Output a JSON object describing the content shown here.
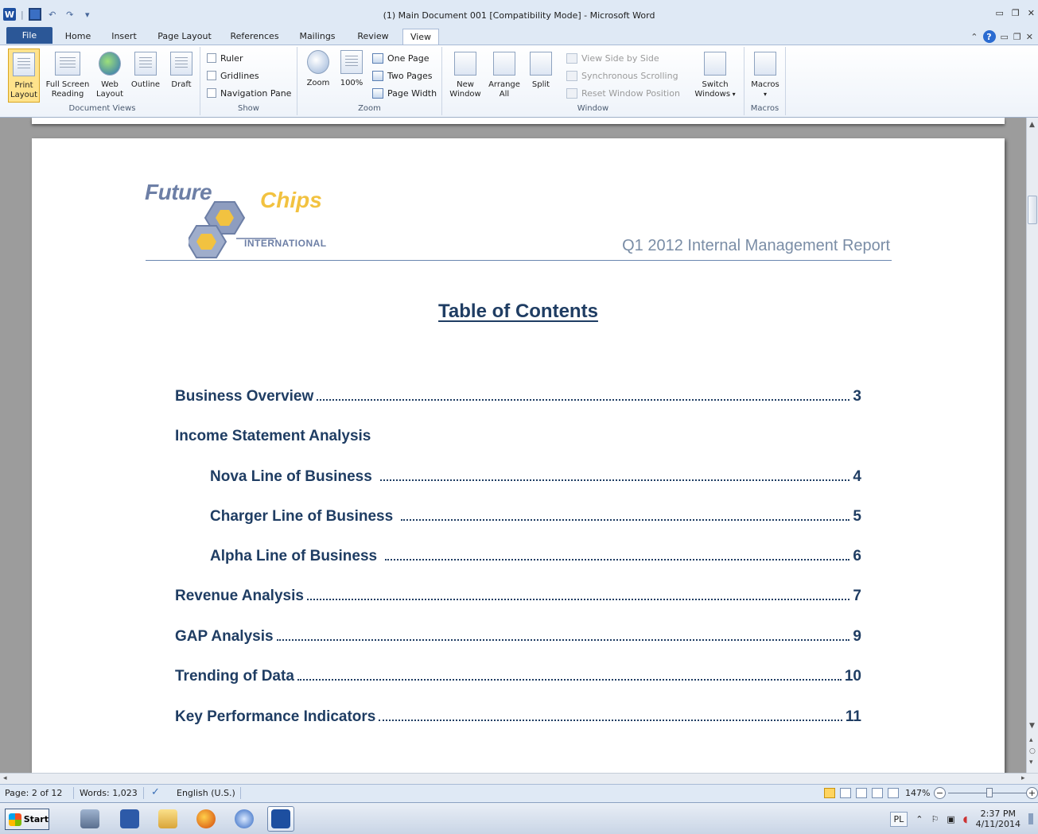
{
  "window": {
    "title": "(1) Main Document 001 [Compatibility Mode] - Microsoft Word"
  },
  "quick_access": {
    "app_icon": "W",
    "items": [
      "save-icon",
      "undo-icon",
      "redo-icon",
      "customize-icon"
    ]
  },
  "tabs": [
    "File",
    "Home",
    "Insert",
    "Page Layout",
    "References",
    "Mailings",
    "Review",
    "View"
  ],
  "active_tab": "View",
  "ribbon": {
    "document_views": {
      "label": "Document Views",
      "buttons": {
        "print_line1": "Print",
        "print_line2": "Layout",
        "fullscreen_line1": "Full Screen",
        "fullscreen_line2": "Reading",
        "web_line1": "Web",
        "web_line2": "Layout",
        "outline": "Outline",
        "draft": "Draft"
      }
    },
    "show": {
      "label": "Show",
      "ruler": "Ruler",
      "gridlines": "Gridlines",
      "navigation_pane": "Navigation Pane"
    },
    "zoom": {
      "label": "Zoom",
      "zoom": "Zoom",
      "hundred": "100%",
      "one_page": "One Page",
      "two_pages": "Two Pages",
      "page_width": "Page Width"
    },
    "window": {
      "label": "Window",
      "new_line1": "New",
      "new_line2": "Window",
      "arrange_line1": "Arrange",
      "arrange_line2": "All",
      "split": "Split",
      "view_side": "View Side by Side",
      "sync_scroll": "Synchronous Scrolling",
      "reset_pos": "Reset Window Position",
      "switch_line1": "Switch",
      "switch_line2": "Windows"
    },
    "macros": {
      "label": "Macros",
      "button": "Macros"
    }
  },
  "document": {
    "logo": {
      "future": "Future",
      "chips": "Chips",
      "international": "INTERNATIONAL"
    },
    "report_title": "Q1 2012 Internal Management Report",
    "toc_heading": "Table of Contents",
    "toc": [
      {
        "label": "Business Overview",
        "page": "3"
      },
      {
        "label": "Income Statement Analysis",
        "page": ""
      },
      {
        "label": "Nova Line of Business",
        "page": "4"
      },
      {
        "label": "Charger Line of Business",
        "page": "5"
      },
      {
        "label": "Alpha Line of Business",
        "page": "6"
      },
      {
        "label": "Revenue Analysis",
        "page": "7"
      },
      {
        "label": "GAP Analysis",
        "page": "9"
      },
      {
        "label": "Trending of Data",
        "page": "10"
      },
      {
        "label": "Key Performance Indicators",
        "page": "11"
      }
    ]
  },
  "status": {
    "page": "Page: 2 of 12",
    "words": "Words: 1,023",
    "language": "English (U.S.)",
    "zoom": "147%",
    "zoom_minus": "−",
    "zoom_plus": "+"
  },
  "taskbar": {
    "start": "Start",
    "lang": "PL",
    "time": "2:37 PM",
    "date": "4/11/2014"
  },
  "colors": {
    "heading": "#1f3d63",
    "logo_blue": "#6d7fa6",
    "logo_gold": "#f2c240",
    "file_tab": "#2b5797"
  }
}
